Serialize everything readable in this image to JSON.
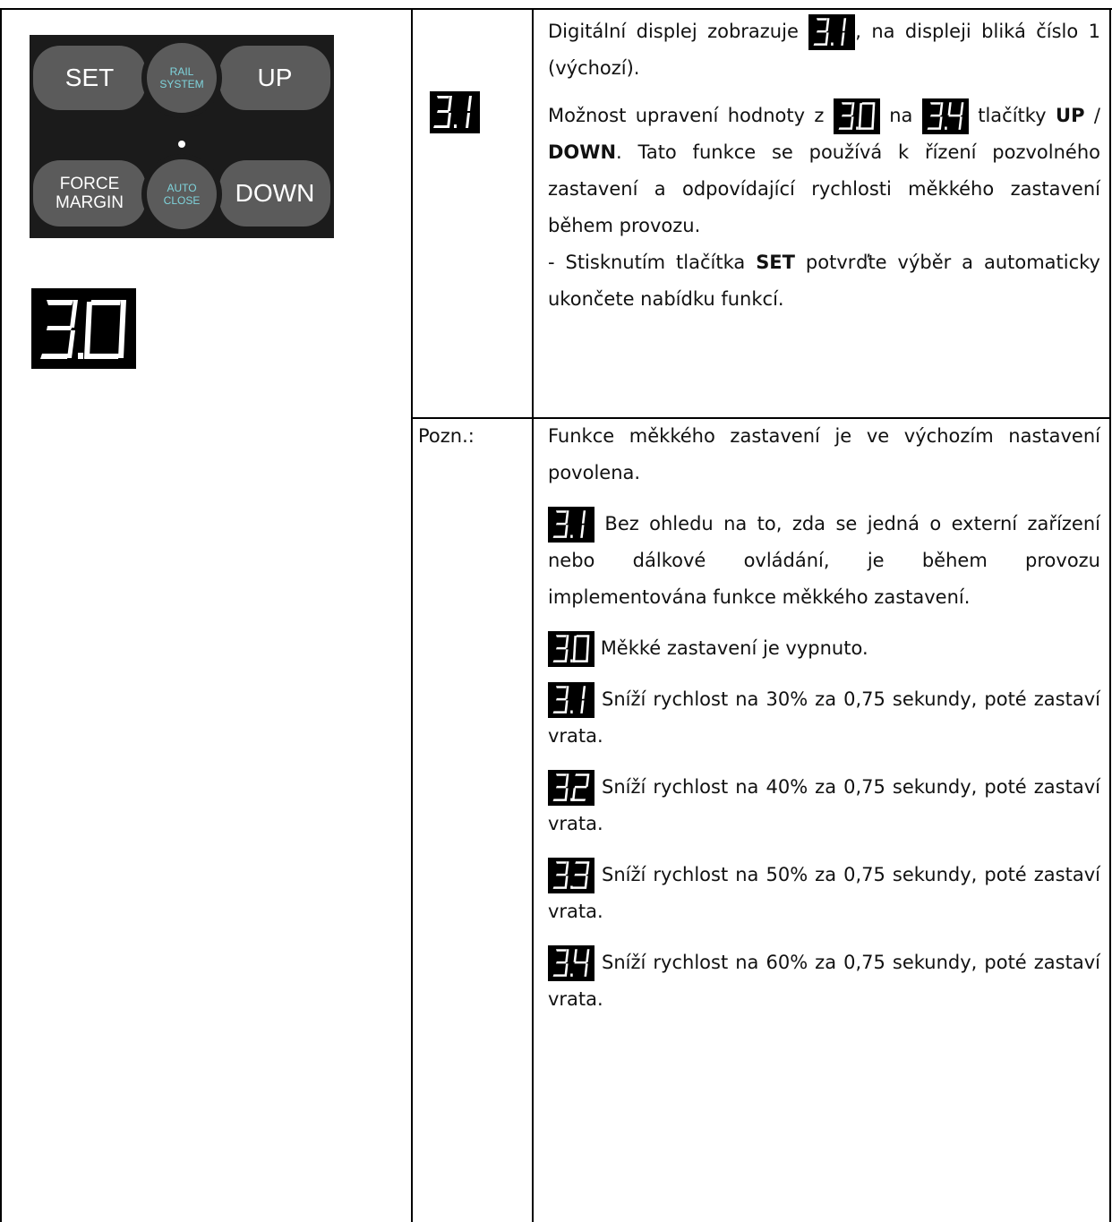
{
  "panel": {
    "set": "SET",
    "rail_1": "RAIL",
    "rail_2": "SYSTEM",
    "up": "UP",
    "force_1": "FORCE",
    "force_2": "MARGIN",
    "auto_1": "AUTO",
    "auto_2": "CLOSE",
    "down": "DOWN"
  },
  "displays": {
    "left": "3.0",
    "middle": "3.1"
  },
  "main": {
    "p1_a": "Digitální displej zobrazuje",
    "p1_b": ", na displeji bliká číslo 1 (výchozí).",
    "p2_a": "Možnost upravení hodnoty z",
    "p2_b": "na",
    "p2_c": "tlačítky",
    "p2_up": "UP",
    "p2_sep": "/",
    "p2_down": "DOWN",
    "p2_d": ". Tato funkce se používá k řízení pozvolného zastavení a odpovídající rychlosti měkkého zastavení během provozu.",
    "p3_a": "- Stisknutím tlačítka",
    "p3_set": "SET",
    "p3_b": "potvrďte výběr a automaticky ukončete nabídku funkcí."
  },
  "note": {
    "label": "Pozn.:",
    "n1": "Funkce měkkého zastavení je ve výchozím nastavení povolena.",
    "n2": "Bez ohledu na to, zda se jedná o externí zařízení nebo dálkové ovládání, je během provozu implementována funkce měkkého zastavení.",
    "n3": "Měkké zastavení je vypnuto.",
    "n4": "Sníží rychlost na 30% za 0,75 sekundy, poté zastaví vrata.",
    "n5": "Sníží rychlost na 40% za 0,75 sekundy, poté zastaví vrata.",
    "n6": "Sníží rychlost na 50% za 0,75 sekundy, poté zastaví vrata.",
    "n7": "Sníží rychlost na 60% za 0,75 sekundy, poté zastaví vrata."
  },
  "colors": {
    "panel_bg": "#1b1b1b",
    "button": "#5b5b5b",
    "accent_text": "#7fd4dc"
  }
}
